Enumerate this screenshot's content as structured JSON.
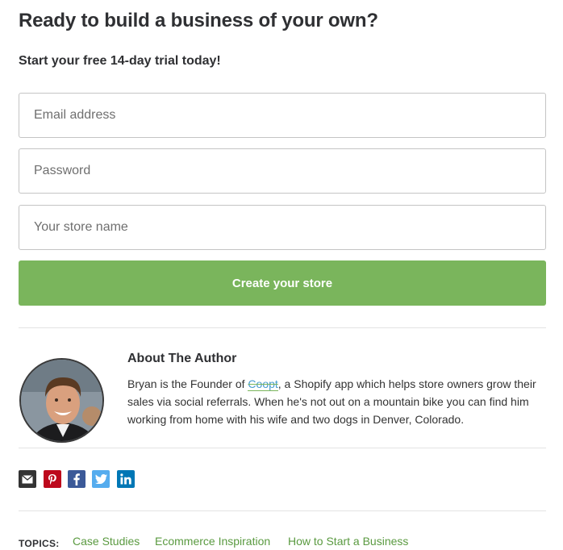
{
  "signup": {
    "heading": "Ready to build a business of your own?",
    "subheading": "Start your free 14-day trial today!",
    "email_placeholder": "Email address",
    "password_placeholder": "Password",
    "store_placeholder": "Your store name",
    "submit_label": "Create your store"
  },
  "author": {
    "title": "About The Author",
    "bio_before": "Bryan is the Founder of ",
    "bio_link": "Coopt",
    "bio_after": ", a Shopify app which helps store owners grow their sales via social referrals. When he's not out on a mountain bike you can find him working from home with his wife and two dogs in Denver, Colorado."
  },
  "share": {
    "icons": [
      "mail-icon",
      "pinterest-icon",
      "facebook-icon",
      "twitter-icon",
      "linkedin-icon"
    ]
  },
  "topics": {
    "label": "TOPICS:",
    "items": [
      "Case Studies",
      "Ecommerce Inspiration",
      "How to Start a Business"
    ]
  },
  "colors": {
    "button_green": "#7ab55c",
    "topic_link": "#5a9a40",
    "divider": "#e3e3e3"
  }
}
